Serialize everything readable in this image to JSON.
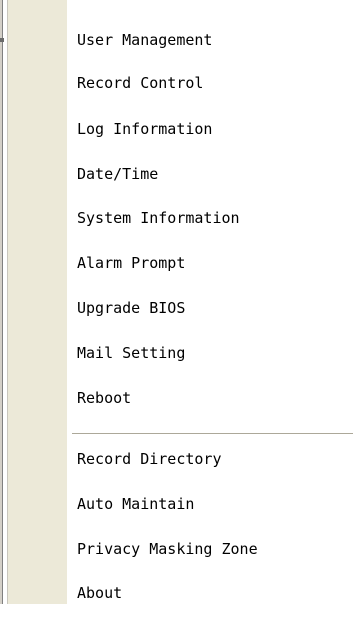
{
  "menu": {
    "group1": [
      {
        "label": "User Management"
      },
      {
        "label": "Record Control"
      },
      {
        "label": "Log Information"
      },
      {
        "label": "Date/Time"
      },
      {
        "label": "System Information"
      },
      {
        "label": "Alarm Prompt"
      },
      {
        "label": "Upgrade BIOS"
      },
      {
        "label": "Mail Setting"
      },
      {
        "label": "Reboot"
      }
    ],
    "group2": [
      {
        "label": "Record Directory"
      },
      {
        "label": "Auto Maintain"
      },
      {
        "label": "Privacy Masking Zone"
      },
      {
        "label": "About"
      }
    ]
  }
}
